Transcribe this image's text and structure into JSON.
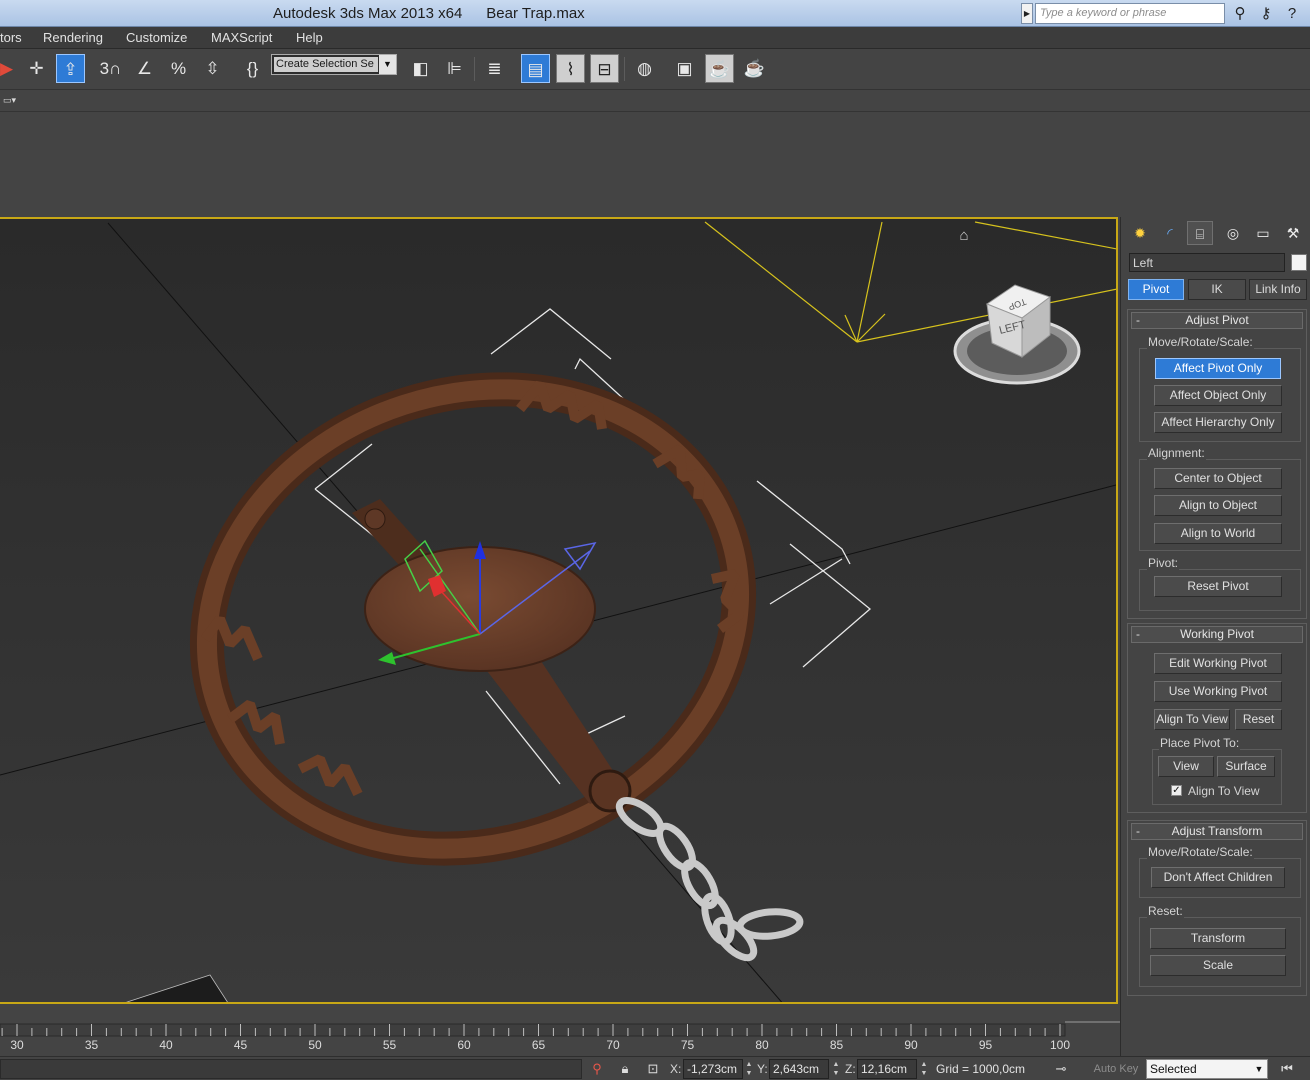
{
  "window": {
    "app_title": "Autodesk 3ds Max  2013 x64",
    "document": "Bear Trap.max",
    "search_placeholder": "Type a keyword or phrase"
  },
  "menu": [
    "tors",
    "Rendering",
    "Customize",
    "MAXScript",
    "Help"
  ],
  "toolbar": {
    "selection_set_value": "Create Selection Se",
    "snap_label": "3"
  },
  "viewport": {
    "viewcube_label": "LEFT",
    "viewcube_top_label": "TOP"
  },
  "command_panel": {
    "object_name": "Left",
    "subtabs": [
      "Pivot",
      "IK",
      "Link Info"
    ],
    "adjust_pivot": {
      "title": "Adjust Pivot",
      "move_group": "Move/Rotate/Scale:",
      "buttons": [
        "Affect Pivot Only",
        "Affect Object Only",
        "Affect Hierarchy Only"
      ],
      "alignment_group": "Alignment:",
      "alignment_buttons": [
        "Center to Object",
        "Align to Object",
        "Align to World"
      ],
      "pivot_group": "Pivot:",
      "reset_pivot": "Reset Pivot"
    },
    "working_pivot": {
      "title": "Working Pivot",
      "edit": "Edit Working Pivot",
      "use": "Use Working Pivot",
      "align_to_view": "Align To View",
      "reset": "Reset",
      "place_group": "Place Pivot To:",
      "view": "View",
      "surface": "Surface",
      "align_check": "Align To View",
      "align_checked": true
    },
    "adjust_transform": {
      "title": "Adjust Transform",
      "move_group": "Move/Rotate/Scale:",
      "dont_affect": "Don't Affect Children",
      "reset_group": "Reset:",
      "transform": "Transform",
      "scale": "Scale"
    }
  },
  "trackbar": {
    "ticks": [
      "30",
      "35",
      "40",
      "45",
      "50",
      "55",
      "60",
      "65",
      "70",
      "75",
      "80",
      "85",
      "90",
      "95",
      "100"
    ]
  },
  "status": {
    "x_label": "X:",
    "x_value": "-1,273cm",
    "y_label": "Y:",
    "y_value": "2,643cm",
    "z_label": "Z:",
    "z_value": "12,16cm",
    "grid": "Grid = 1000,0cm",
    "auto_key": "Auto Key",
    "selection_mode": "Selected"
  },
  "colors": {
    "active_blue": "#2e7bd6",
    "viewport_border": "#c8a816",
    "trap_rust": "#6b3f27"
  }
}
